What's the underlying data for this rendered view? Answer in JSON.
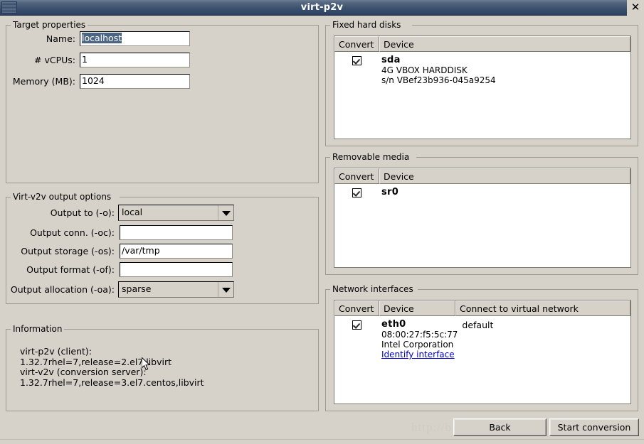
{
  "window": {
    "title": "virt-p2v",
    "close_label": "✕"
  },
  "target_properties": {
    "legend": "Target properties",
    "fields": [
      {
        "label": "Name:",
        "value": "localhost",
        "selected": true
      },
      {
        "label": "# vCPUs:",
        "value": "1",
        "selected": false
      },
      {
        "label": "Memory (MB):",
        "value": "1024",
        "selected": false
      }
    ]
  },
  "output_options": {
    "legend": "Virt-v2v output options",
    "output_to": {
      "label": "Output to (-o):",
      "value": "local"
    },
    "output_conn": {
      "label": "Output conn. (-oc):",
      "value": ""
    },
    "output_storage": {
      "label": "Output storage (-os):",
      "value": "/var/tmp"
    },
    "output_format": {
      "label": "Output format (-of):",
      "value": ""
    },
    "output_allocation": {
      "label": "Output allocation (-oa):",
      "value": "sparse"
    }
  },
  "information": {
    "legend": "Information",
    "text": "virt-p2v (client):\n1.32.7rhel=7,release=2.el7,libvirt\nvirt-v2v (conversion server):\n1.32.7rhel=7,release=3.el7.centos,libvirt"
  },
  "fixed_hard_disks": {
    "legend": "Fixed hard disks",
    "columns": [
      "Convert",
      "Device"
    ],
    "rows": [
      {
        "convert": true,
        "device": "sda",
        "details": [
          "4G VBOX HARDDISK",
          "s/n VBef23b936-045a9254"
        ]
      }
    ]
  },
  "removable_media": {
    "legend": "Removable media",
    "columns": [
      "Convert",
      "Device"
    ],
    "rows": [
      {
        "convert": true,
        "device": "sr0",
        "details": []
      }
    ]
  },
  "network_interfaces": {
    "legend": "Network interfaces",
    "columns": [
      "Convert",
      "Device",
      "Connect to virtual network"
    ],
    "rows": [
      {
        "convert": true,
        "device": "eth0",
        "details": [
          "08:00:27:f5:5c:77",
          "Intel Corporation"
        ],
        "link": "Identify interface",
        "network": "default"
      }
    ]
  },
  "footer": {
    "back_label": "Back",
    "start_label": "Start conversion",
    "watermark": "http://blog.csdn.net/zhanhailiang"
  }
}
